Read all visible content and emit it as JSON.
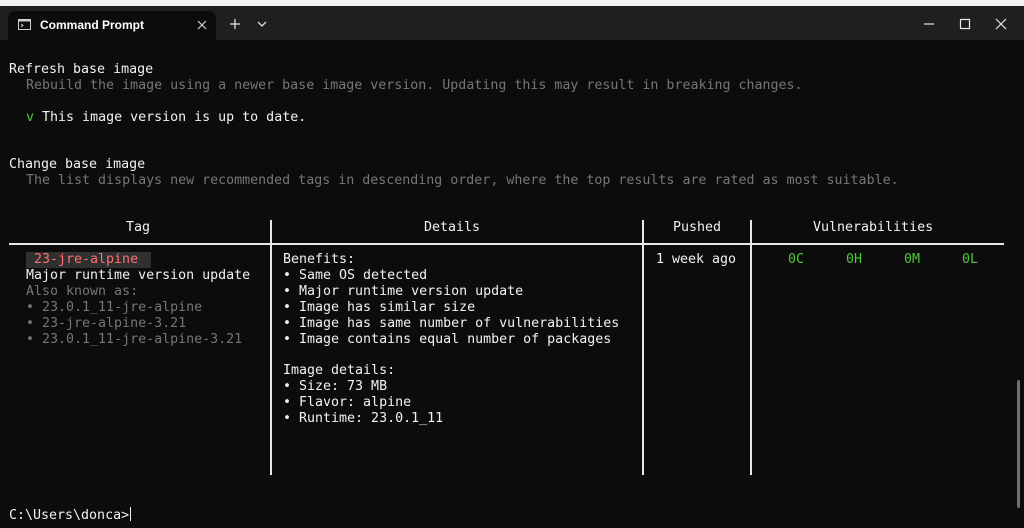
{
  "window": {
    "tab_title": "Command Prompt",
    "icons": [
      "terminal-icon",
      "close-icon",
      "plus-icon",
      "chevron-down-icon",
      "minimize-icon",
      "maximize-icon",
      "window-close-icon"
    ]
  },
  "refresh": {
    "heading": "Refresh base image",
    "description": "Rebuild the image using a newer base image version. Updating this may result in breaking changes.",
    "status_mark": "v",
    "status_text": "This image version is up to date."
  },
  "change": {
    "heading": "Change base image",
    "description": "The list displays new recommended tags in descending order, where the top results are rated as most suitable."
  },
  "table": {
    "headers": {
      "tag": "Tag",
      "details": "Details",
      "pushed": "Pushed",
      "vulnerabilities": "Vulnerabilities"
    },
    "row": {
      "tag": "23-jre-alpine",
      "tag_subtitle": "Major runtime version update",
      "also_known_label": "Also known as:",
      "aliases": [
        "• 23.0.1_11-jre-alpine",
        "• 23-jre-alpine-3.21",
        "• 23.0.1_11-jre-alpine-3.21"
      ],
      "benefits_label": "Benefits:",
      "benefits": [
        "• Same OS detected",
        "• Major runtime version update",
        "• Image has similar size",
        "• Image has same number of vulnerabilities",
        "• Image contains equal number of packages"
      ],
      "image_details_label": "Image details:",
      "image_details": [
        "• Size: 73 MB",
        "• Flavor: alpine",
        "• Runtime: 23.0.1_11"
      ],
      "pushed": "1 week ago",
      "vulns": {
        "c": "0C",
        "h": "0H",
        "m": "0M",
        "l": "0L"
      }
    }
  },
  "prompt": "C:\\Users\\donca>",
  "colors": {
    "background": "#0c0c0c",
    "titlebar": "#1f1f1f",
    "green": "#4ec73a",
    "tag": "#ff6e6e",
    "dim": "#767676"
  }
}
